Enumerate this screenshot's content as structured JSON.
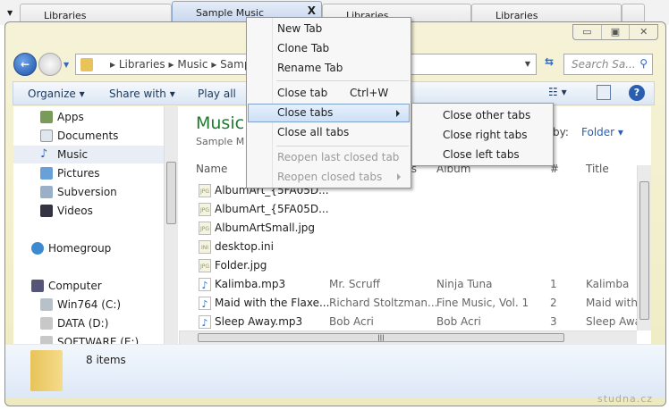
{
  "tabs": [
    {
      "label": "Libraries"
    },
    {
      "label": "Sample Music",
      "close": "X"
    },
    {
      "label": "Libraries"
    },
    {
      "label": "Libraries"
    }
  ],
  "address": {
    "crumbs": [
      "Libraries",
      "Music",
      "Samp"
    ]
  },
  "search": {
    "placeholder": "Search Sa..."
  },
  "toolbar": {
    "organize": "Organize",
    "share": "Share with",
    "play": "Play all"
  },
  "nav": {
    "items": [
      "Apps",
      "Documents",
      "Music",
      "Pictures",
      "Subversion",
      "Videos",
      "Homegroup",
      "Computer",
      "Win764 (C:)",
      "DATA (D:)",
      "SOFTWARE (E:)"
    ]
  },
  "library": {
    "title": "Music",
    "subtitle": "Sample M",
    "arrange_label": "by:",
    "arrange_value": "Folder"
  },
  "columns": {
    "name": "Name",
    "artists": "ts",
    "album": "Album",
    "num": "#",
    "title": "Title"
  },
  "files": [
    {
      "name": "AlbumArt_{5FA05D...",
      "type": "JPG",
      "artist": "",
      "album": "",
      "num": "",
      "title": ""
    },
    {
      "name": "AlbumArt_{5FA05D...",
      "type": "JPG",
      "artist": "",
      "album": "",
      "num": "",
      "title": ""
    },
    {
      "name": "AlbumArtSmall.jpg",
      "type": "JPG",
      "artist": "",
      "album": "",
      "num": "",
      "title": ""
    },
    {
      "name": "desktop.ini",
      "type": "INI",
      "artist": "",
      "album": "",
      "num": "",
      "title": ""
    },
    {
      "name": "Folder.jpg",
      "type": "JPG",
      "artist": "",
      "album": "",
      "num": "",
      "title": ""
    },
    {
      "name": "Kalimba.mp3",
      "type": "MP3",
      "artist": "Mr. Scruff",
      "album": "Ninja Tuna",
      "num": "1",
      "title": "Kalimba"
    },
    {
      "name": "Maid with the Flaxe...",
      "type": "MP3",
      "artist": "Richard Stoltzman...",
      "album": "Fine Music, Vol. 1",
      "num": "2",
      "title": "Maid with t"
    },
    {
      "name": "Sleep Away.mp3",
      "type": "MP3",
      "artist": "Bob Acri",
      "album": "Bob Acri",
      "num": "3",
      "title": "Sleep Away"
    }
  ],
  "status": {
    "count": "8 items"
  },
  "menu": {
    "new_tab": "New Tab",
    "clone_tab": "Clone Tab",
    "rename_tab": "Rename Tab",
    "close_tab": "Close tab",
    "close_tab_shortcut": "Ctrl+W",
    "close_tabs": "Close tabs",
    "close_all": "Close all tabs",
    "reopen_last": "Reopen last closed tab",
    "reopen_closed": "Reopen closed tabs"
  },
  "submenu": {
    "other": "Close other tabs",
    "right": "Close right tabs",
    "left": "Close left tabs"
  },
  "watermark": "studna.cz"
}
